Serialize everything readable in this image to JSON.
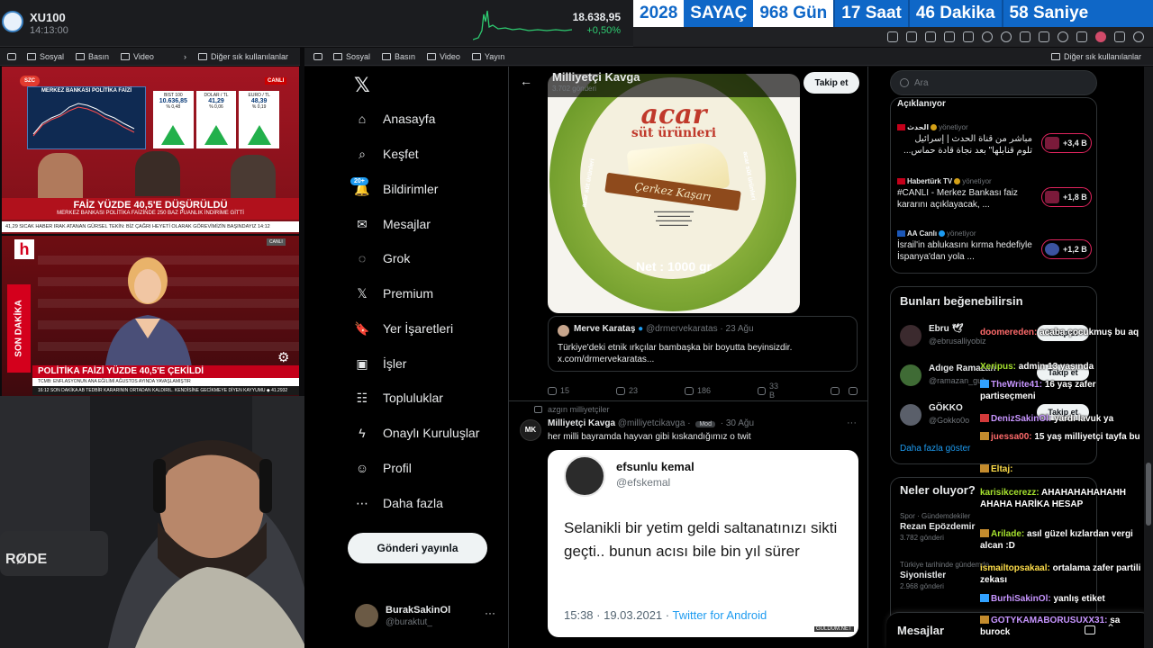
{
  "ticker": {
    "symbol": "XU100",
    "time": "14:13:00",
    "price": "18.638,95",
    "change": "+0,50%"
  },
  "countdown": {
    "year": "2028",
    "label": "SAYAÇ",
    "days": "968 Gün",
    "hours": "17 Saat",
    "minutes": "46 Dakika",
    "seconds": "58 Saniye"
  },
  "bookmarks_left": {
    "items": [
      "Sosyal",
      "Basın",
      "Video"
    ],
    "others": "Diğer sık kullanılanlar"
  },
  "bookmarks_right": {
    "items": [
      "Sosyal",
      "Basın",
      "Video",
      "Yayın"
    ],
    "others": "Diğer sık kullanılanlar"
  },
  "tv1": {
    "chart_title": "MERKEZ BANKASI POLİTİKA FAİZİ",
    "tiles": [
      {
        "label": "BIST 100",
        "value": "10.636,85",
        "chg": "% 0,48"
      },
      {
        "label": "DOLAR / TL",
        "value": "41,29",
        "chg": "% 0,06"
      },
      {
        "label": "EURO / TL",
        "value": "48,39",
        "chg": "% 0,19"
      }
    ],
    "headline": "FAİZ YÜZDE 40,5'E DÜŞÜRÜLDÜ",
    "sub": "MERKEZ BANKASI POLİTİKA FAİZİNDE 250 BAZ PUANLIK İNDİRİME GİTTİ",
    "badge": "SZC",
    "live": "CANLI",
    "strip": "41,29   SICAK HABER   IRAK ATANAN GÜRSEL TEKİN: BİZ ÇAĞRI HEYETİ OLARAK GÖREVİMİZİN BAŞINDAYIZ   14:12"
  },
  "tv2": {
    "channel": "h",
    "vertical": "SON DAKİKA",
    "live": "CANLI",
    "headline": "POLİTİKA FAİZİ YÜZDE 40,5'E ÇEKİLDİ",
    "sub": "TCMB: ENFLASYONUN ANA EĞİLİMİ AĞUSTOS AYINDA YAVAŞLAMIŞTIR",
    "ticker": "16:12   SON DAKİKA   AB TEDBİR KARARININ ORTADAN KALDIRIL. KENDİSİNE GECİKMEYE DİYEN KAYYUMU   ◆ 41.2932"
  },
  "nav": {
    "items": [
      {
        "label": "Anasayfa",
        "icon": "home-icon"
      },
      {
        "label": "Keşfet",
        "icon": "search-icon"
      },
      {
        "label": "Bildirimler",
        "icon": "bell-icon",
        "badge": "20+"
      },
      {
        "label": "Mesajlar",
        "icon": "mail-icon"
      },
      {
        "label": "Grok",
        "icon": "grok-icon"
      },
      {
        "label": "Premium",
        "icon": "x-icon"
      },
      {
        "label": "Yer İşaretleri",
        "icon": "bookmark-icon"
      },
      {
        "label": "İşler",
        "icon": "briefcase-icon"
      },
      {
        "label": "Topluluklar",
        "icon": "people-icon"
      },
      {
        "label": "Onaylı Kuruluşlar",
        "icon": "lightning-icon"
      },
      {
        "label": "Profil",
        "icon": "person-icon"
      },
      {
        "label": "Daha fazla",
        "icon": "more-circle-icon"
      }
    ],
    "post_button": "Gönderi yayınla",
    "me": {
      "name": "BurakSakinOl",
      "handle": "@buraktut_"
    }
  },
  "feed": {
    "title": "Milliyetçi Kavga",
    "subtitle": "3.702 gönderi",
    "follow": "Takip et",
    "cheese": {
      "brand": "acar",
      "brand_sub": "süt ürünleri",
      "product": "Çerkez Kaşarı",
      "net": "Net : 1000 gr",
      "ring": "acar süt ürünleri"
    },
    "quote": {
      "name": "Merve Karataş",
      "handle": "@drmervekaratas",
      "date": "23 Ağu",
      "text": "Türkiye'deki etnik ırkçılar bambaşka bir boyutta beyinsizdir. x.com/drmervekaratas..."
    },
    "actions1": {
      "replies": "15",
      "reposts": "23",
      "likes": "186",
      "views": "33 B"
    },
    "tweet2": {
      "context": "azgın milliyetçiler",
      "avatar": "MK",
      "name": "Milliyetçi Kavga",
      "handle": "@milliyetcikavga",
      "mod": "Mod",
      "date": "30 Ağu",
      "text": "her milli bayramda hayvan gibi kıskandığımız o twit",
      "embed": {
        "name": "efsunlu kemal",
        "handle": "@efskemal",
        "text": "Selanikli bir yetim geldi saltanatınızı sikti geçti.. bunun acısı bile bin yıl sürer",
        "date": "15:38 · 19.03.2021 · ",
        "source": "Twitter for Android",
        "watermark": "GULDUM.NET"
      }
    }
  },
  "right": {
    "search_placeholder": "Ara",
    "live": [
      {
        "source": "",
        "role": "",
        "title": "Açıklanıyor",
        "count": ""
      },
      {
        "source": "الحدث",
        "role": "yönetiyor",
        "title": "مباشر من قناة الحدث | إسرائيل تلوم قنابلها\" بعد نجاة قادة حماس...",
        "count": "+3,4 B"
      },
      {
        "source": "Habertürk TV",
        "role": "yönetiyor",
        "title": "#CANLI - Merkez Bankası faiz kararını açıklayacak, ...",
        "count": "+1,8 B"
      },
      {
        "source": "AA Canlı",
        "role": "yönetiyor",
        "title": "İsrail'in ablukasını kırma hedefiyle İspanya'dan yola ...",
        "count": "+1,2 B"
      }
    ],
    "wtf_title": "Bunları beğenebilirsin",
    "suggestions": [
      {
        "name": "Ebru 🕊",
        "handle": "@ebrusalliyobiz",
        "btn": "Takip et"
      },
      {
        "name": "Adıge Ramazan",
        "handle": "@ramazan_gub",
        "btn": "Takip et"
      },
      {
        "name": "GÖKKO",
        "handle": "@Gokko0o",
        "btn": "Takip et"
      }
    ],
    "show_more": "Daha fazla göster",
    "trends_title": "Neler oluyor?",
    "trends": [
      {
        "cat": "Spor · Gündemdekiler",
        "name": "Rezan Epözdemir",
        "posts": "3.782 gönderi"
      },
      {
        "cat": "Türkiye tarihinde gündemde",
        "name": "Siyonistler",
        "posts": "2.968 gönderi"
      }
    ],
    "messages": "Mesajlar"
  },
  "chat": [
    {
      "user": "doomereden:",
      "text": "acaba çocukmuş bu aq",
      "uc": "r",
      "badge": ""
    },
    {
      "user": "Xeripus:",
      "text": "admin 13 yaşında",
      "uc": "g",
      "badge": ""
    },
    {
      "user": "TheWrite41:",
      "text": "16 yaş zafer partiseçmeni",
      "uc": "p",
      "badge": "b"
    },
    {
      "user": "DenizSakinOl:",
      "text": "yardı lavuk ya",
      "uc": "p",
      "badge": "r"
    },
    {
      "user": "juessa00:",
      "text": "15 yaş milliyetçi tayfa bu",
      "uc": "r",
      "badge": "y"
    },
    {
      "user": "Eltaj:",
      "text": "",
      "uc": "",
      "badge": "y"
    },
    {
      "user": "karisikcerezz:",
      "text": "AHAHAHAHAHAHH AHAHA HARİKA HESAP",
      "uc": "g",
      "badge": ""
    },
    {
      "user": "Arilade:",
      "text": "asıl güzel kızlardan vergi alcan :D",
      "uc": "g",
      "badge": "y"
    },
    {
      "user": "ismailtopsakaal:",
      "text": "ortalama zafer partili zekası",
      "uc": "",
      "badge": ""
    },
    {
      "user": "BurhiSakinOl:",
      "text": "yanlış etiket",
      "uc": "p",
      "badge": "b"
    },
    {
      "user": "GOTYKAMABORUSUXX31:",
      "text": "sa burock",
      "uc": "p",
      "badge": "y"
    }
  ]
}
